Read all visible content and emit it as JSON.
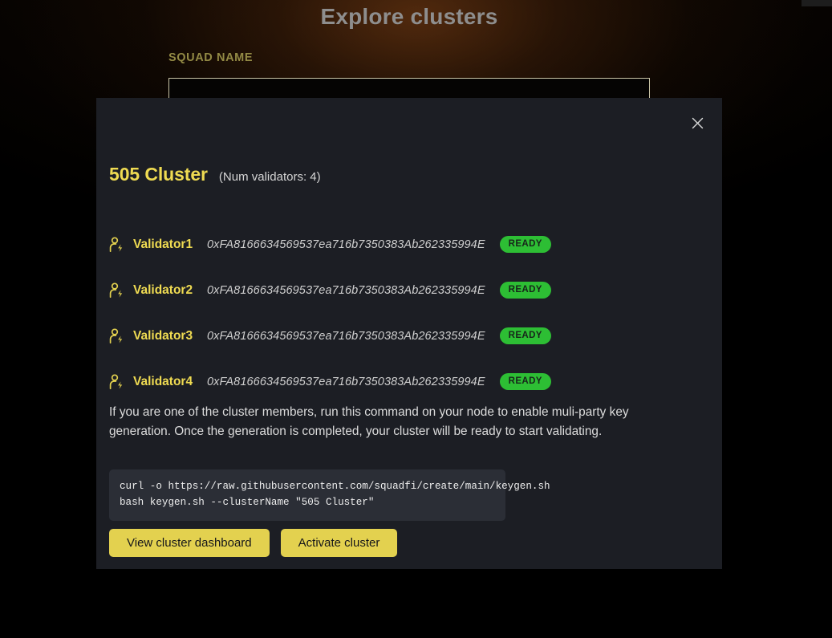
{
  "page": {
    "title": "Explore clusters",
    "squad_name_label": "SQUAD NAME",
    "squad_name_value": "",
    "squad_name_placeholder": ""
  },
  "modal": {
    "close_icon": "close-icon",
    "cluster_title": "505 Cluster",
    "cluster_subtitle": "(Num validators: 4)",
    "validator_icon": "user-lightning-icon",
    "validators": [
      {
        "name": "Validator1",
        "address": "0xFA8166634569537ea716b7350383Ab262335994E",
        "status": "READY"
      },
      {
        "name": "Validator2",
        "address": "0xFA8166634569537ea716b7350383Ab262335994E",
        "status": "READY"
      },
      {
        "name": "Validator3",
        "address": "0xFA8166634569537ea716b7350383Ab262335994E",
        "status": "READY"
      },
      {
        "name": "Validator4",
        "address": "0xFA8166634569537ea716b7350383Ab262335994E",
        "status": "READY"
      }
    ],
    "description": "If you are one of the cluster members, run this command on your node to enable muli-party key generation. Once the generation is completed, your cluster will be ready to start validating.",
    "code": {
      "line1": "curl -o https://raw.githubusercontent.com/squadfi/create/main/keygen.sh",
      "line2": "bash keygen.sh --clusterName \"505 Cluster\""
    },
    "buttons": {
      "view_dashboard": "View cluster dashboard",
      "activate_cluster": "Activate cluster"
    }
  },
  "colors": {
    "accent_yellow": "#efdb52",
    "button_yellow": "#e3d14f",
    "status_green": "#2dbe34",
    "modal_bg": "#1c1e24",
    "code_bg": "#2b2e36",
    "page_title_gray": "#8e8e8e",
    "label_olive": "#938a45"
  }
}
